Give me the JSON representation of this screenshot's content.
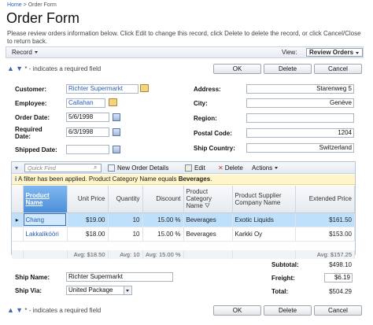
{
  "breadcrumb": {
    "home": "Home",
    "sep": ">",
    "current": "Order Form"
  },
  "title": "Order Form",
  "description": "Please review orders information below. Click Edit to change this record, click Delete to delete the record, or click Cancel/Close to return back.",
  "toolbar": {
    "record_label": "Record",
    "view_label": "View:",
    "view_value": "Review Orders"
  },
  "nav": {
    "up": "▲",
    "down": "▼",
    "required_note": "* - indicates a required field"
  },
  "buttons": {
    "ok": "OK",
    "delete": "Delete",
    "cancel": "Cancel"
  },
  "form": {
    "customer_label": "Customer:",
    "customer_value": "Richter Supermarkt",
    "employee_label": "Employee:",
    "employee_value": "Callahan",
    "order_date_label": "Order Date:",
    "order_date_value": "5/6/1998",
    "required_date_label": "Required Date:",
    "required_date_value": "6/3/1998",
    "shipped_date_label": "Shipped Date:",
    "shipped_date_value": "",
    "address_label": "Address:",
    "address_value": "Starenweg 5",
    "city_label": "City:",
    "city_value": "Genève",
    "region_label": "Region:",
    "region_value": "",
    "postal_label": "Postal Code:",
    "postal_value": "1204",
    "country_label": "Ship Country:",
    "country_value": "Switzerland"
  },
  "grid": {
    "quick_find": "Quick Find",
    "new_label": "New Order Details",
    "edit_label": "Edit",
    "delete_label": "Delete",
    "actions_label": "Actions",
    "filter_prefix": "A filter has been applied. Product Category Name equals",
    "filter_value": "Beverages",
    "headers": [
      "Product Name",
      "Unit Price",
      "Quantity",
      "Discount",
      "Product Category Name",
      "Product Supplier Company Name",
      "Extended Price"
    ],
    "rows": [
      [
        "Chang",
        "$19.00",
        "10",
        "15.00 %",
        "Beverages",
        "Exotic Liquids",
        "$161.50"
      ],
      [
        "Lakkalikööri",
        "$18.00",
        "10",
        "15.00 %",
        "Beverages",
        "Karkki Oy",
        "$153.00"
      ]
    ],
    "footer": {
      "avg_price": "Avg: $18.50",
      "avg_qty": "Avg: 10",
      "avg_disc": "Avg: 15.00 %",
      "avg_ext": "Avg: $157.25"
    }
  },
  "totals": {
    "subtotal_label": "Subtotal:",
    "subtotal_value": "$498.10",
    "freight_label": "Freight:",
    "freight_value": "$6.19",
    "total_label": "Total:",
    "total_value": "$504.29"
  },
  "shipping": {
    "ship_name_label": "Ship Name:",
    "ship_name_value": "Richter Supermarkt",
    "ship_via_label": "Ship Via:",
    "ship_via_value": "United Package"
  }
}
